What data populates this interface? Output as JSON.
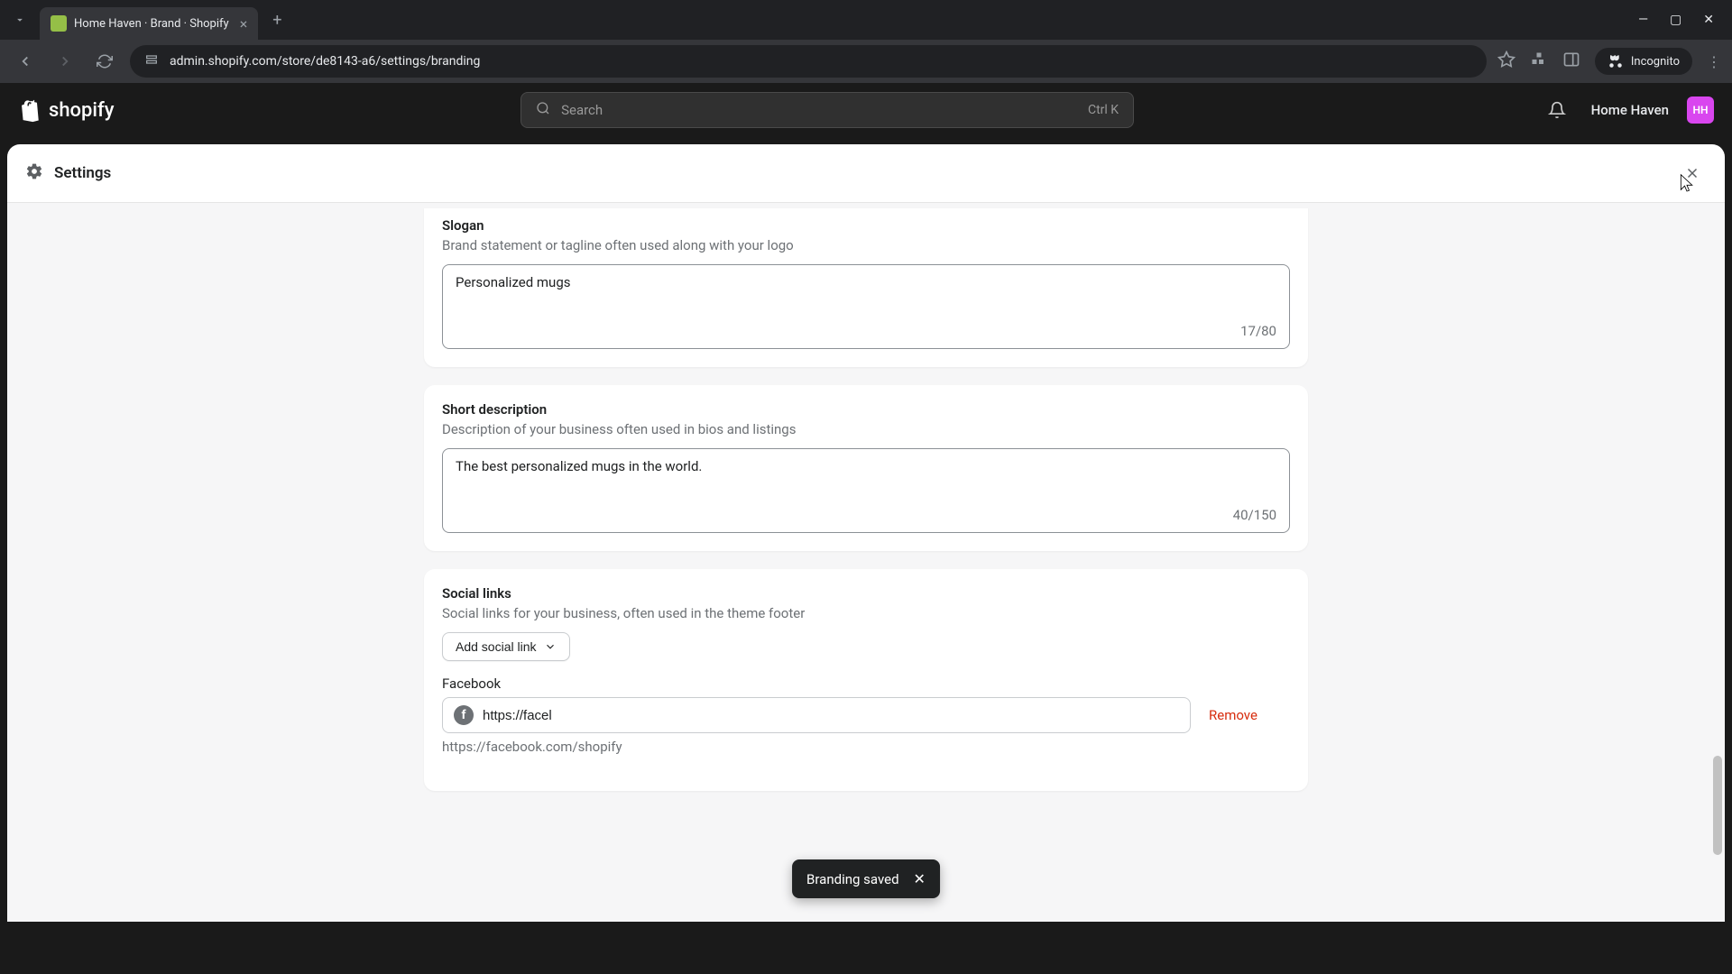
{
  "browser": {
    "tab_title": "Home Haven · Brand · Shopify",
    "url": "admin.shopify.com/store/de8143-a6/settings/branding",
    "incognito_label": "Incognito"
  },
  "header": {
    "logo_text": "shopify",
    "search_placeholder": "Search",
    "search_shortcut": "Ctrl K",
    "store_name": "Home Haven",
    "store_initials": "HH"
  },
  "settings": {
    "title": "Settings"
  },
  "slogan": {
    "title": "Slogan",
    "desc": "Brand statement or tagline often used along with your logo",
    "value": "Personalized mugs",
    "count": "17/80"
  },
  "short_desc": {
    "title": "Short description",
    "desc": "Description of your business often used in bios and listings",
    "value": "The best personalized mugs in the world.",
    "count": "40/150"
  },
  "social": {
    "title": "Social links",
    "desc": "Social links for your business, often used in the theme footer",
    "add_label": "Add social link",
    "facebook_label": "Facebook",
    "facebook_value": "https://facel",
    "remove_label": "Remove",
    "helper": "https://facebook.com/shopify"
  },
  "toast": {
    "message": "Branding saved"
  }
}
